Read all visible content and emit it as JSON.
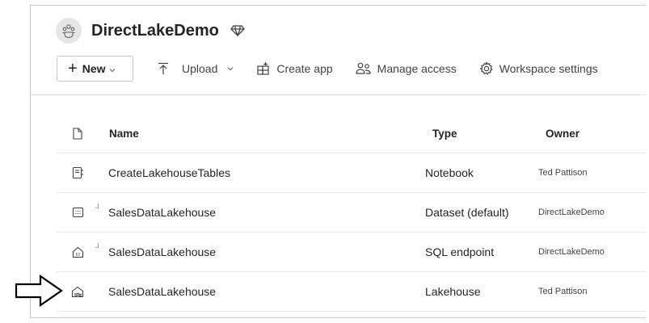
{
  "workspace": {
    "title": "DirectLakeDemo",
    "icon": "workspace-people-icon",
    "badge_icon": "premium-diamond-icon"
  },
  "toolbar": {
    "new_label": "New",
    "upload_label": "Upload",
    "create_app_label": "Create app",
    "manage_access_label": "Manage access",
    "workspace_settings_label": "Workspace settings"
  },
  "table": {
    "columns": {
      "icon": "file-icon",
      "name": "Name",
      "type": "Type",
      "owner": "Owner"
    },
    "rows": [
      {
        "icon": "notebook-icon",
        "name": "CreateLakehouseTables",
        "type": "Notebook",
        "owner": "Ted Pattison"
      },
      {
        "icon": "dataset-icon",
        "name": "SalesDataLakehouse",
        "type": "Dataset (default)",
        "owner": "DirectLakeDemo"
      },
      {
        "icon": "sql-endpoint-icon",
        "name": "SalesDataLakehouse",
        "type": "SQL endpoint",
        "owner": "DirectLakeDemo"
      },
      {
        "icon": "lakehouse-icon",
        "name": "SalesDataLakehouse",
        "type": "Lakehouse",
        "owner": "Ted Pattison"
      }
    ]
  },
  "colors": {
    "border": "#c8c8c8",
    "text": "#242424",
    "divider": "#e8e8e8"
  }
}
